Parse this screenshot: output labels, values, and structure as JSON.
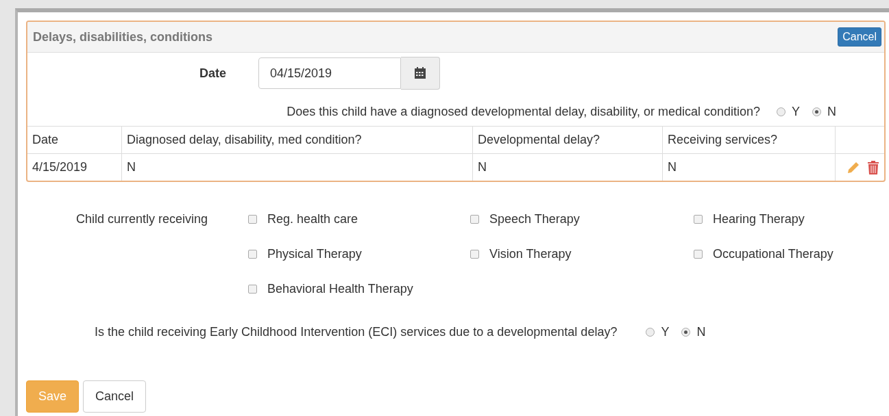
{
  "panel": {
    "title": "Delays, disabilities, conditions",
    "cancel_button": "Cancel",
    "date_label": "Date",
    "date_value": "04/15/2019",
    "question": "Does this child have a diagnosed developmental delay, disability, or medical condition?",
    "question_options": [
      {
        "label": "Y",
        "selected": false
      },
      {
        "label": "N",
        "selected": true
      }
    ],
    "table": {
      "columns": [
        "Date",
        "Diagnosed delay, disability, med condition?",
        "Developmental delay?",
        "Receiving services?"
      ],
      "rows": [
        {
          "cells": [
            "4/15/2019",
            "N",
            "N",
            "N"
          ]
        }
      ]
    }
  },
  "receiving": {
    "label": "Child currently receiving",
    "options": [
      {
        "label": "Reg. health care",
        "checked": false
      },
      {
        "label": "Speech Therapy",
        "checked": false
      },
      {
        "label": "Hearing Therapy",
        "checked": false
      },
      {
        "label": "Physical Therapy",
        "checked": false
      },
      {
        "label": "Vision Therapy",
        "checked": false
      },
      {
        "label": "Occupational Therapy",
        "checked": false
      },
      {
        "label": "Behavioral Health Therapy",
        "checked": false
      }
    ]
  },
  "eci": {
    "question": "Is the child receiving Early Childhood Intervention (ECI) services due to a developmental delay?",
    "options": [
      {
        "label": "Y",
        "selected": false
      },
      {
        "label": "N",
        "selected": true
      }
    ]
  },
  "buttons": {
    "save": "Save",
    "cancel": "Cancel"
  }
}
